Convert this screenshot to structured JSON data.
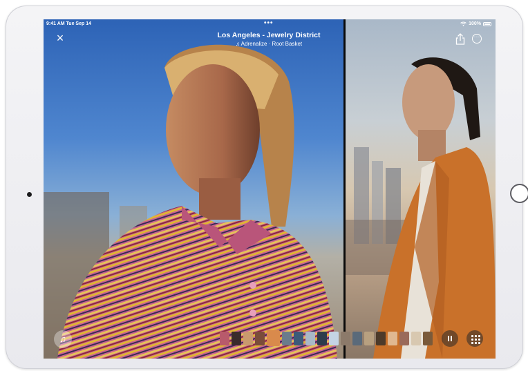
{
  "status_bar": {
    "time": "9:41 AM",
    "date": "Tue Sep 14",
    "dots": "•••",
    "battery": "100%"
  },
  "header": {
    "title": "Los Angeles - Jewelry District",
    "subtitle": "♫ Adrenalize · Root Basket",
    "close_icon": "×"
  },
  "controls": {
    "music_icon": "♫"
  },
  "filmstrip": {
    "colors": [
      "#b85a6b",
      "#3a2b2b",
      "#c99a6e",
      "#7a4c3a",
      "#d98a4c",
      "#6b7c8c",
      "#3c5a7a",
      "#a8b8c8",
      "#2c3c4c",
      "#c4d4e4",
      "#8c7a6a",
      "#5a6a7a",
      "#b8a080",
      "#4c3a2a",
      "#e0b890",
      "#9a6a5a",
      "#d8c8b0",
      "#7a5a3a"
    ],
    "selected_index": 4
  },
  "colors": {
    "accent": "#ffffff",
    "screen_bg": "#000000"
  }
}
